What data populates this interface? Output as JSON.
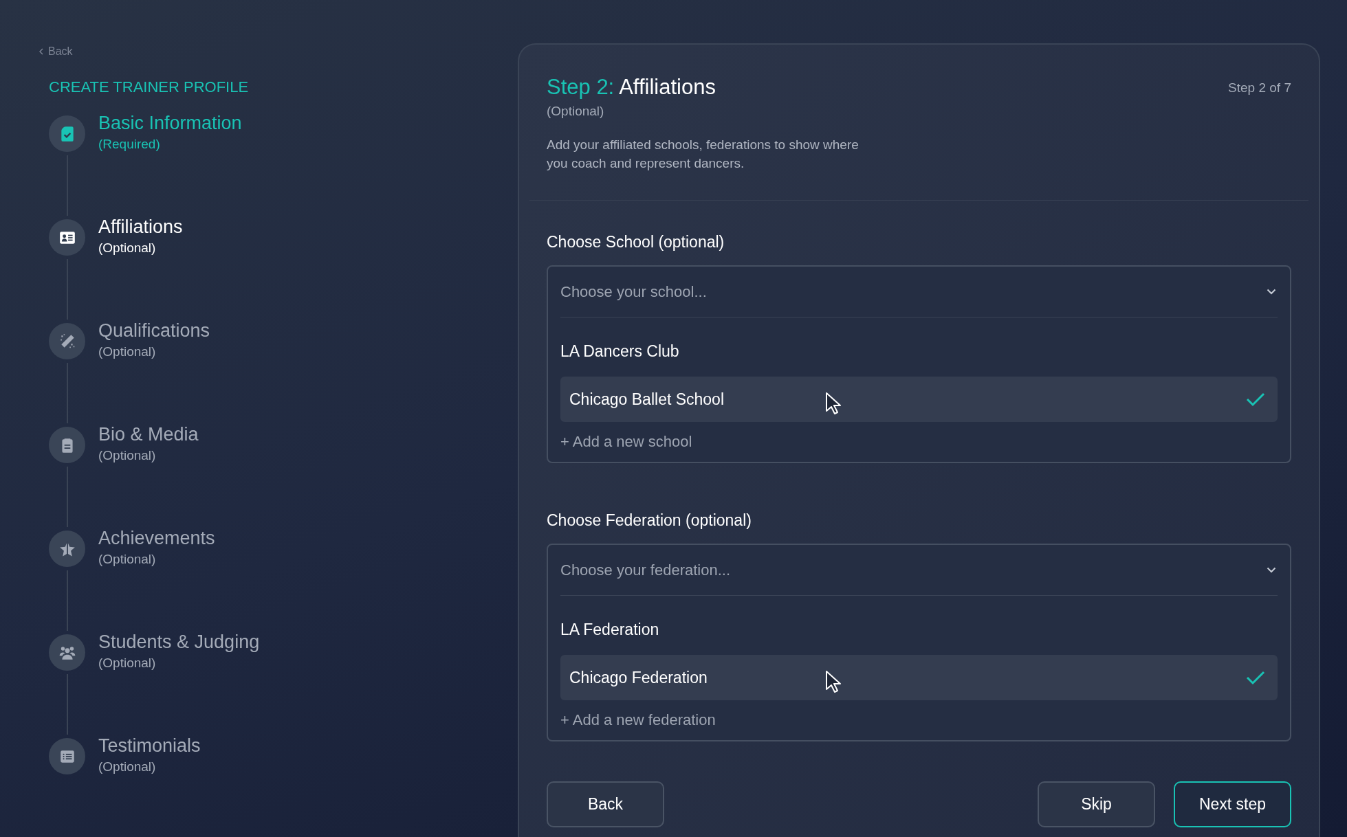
{
  "back_link": {
    "label": "Back"
  },
  "sidebar": {
    "title": "CREATE TRAINER PROFILE",
    "steps": [
      {
        "title": "Basic Information",
        "subtitle": "(Required)",
        "completed": true,
        "selected": false
      },
      {
        "title": "Affiliations",
        "subtitle": "(Optional)",
        "completed": false,
        "selected": true
      },
      {
        "title": "Qualifications",
        "subtitle": "(Optional)",
        "completed": false,
        "selected": false
      },
      {
        "title": "Bio & Media",
        "subtitle": "(Optional)",
        "completed": false,
        "selected": false
      },
      {
        "title": "Achievements",
        "subtitle": "(Optional)",
        "completed": false,
        "selected": false
      },
      {
        "title": "Students & Judging",
        "subtitle": "(Optional)",
        "completed": false,
        "selected": false
      },
      {
        "title": "Testimonials",
        "subtitle": "(Optional)",
        "completed": false,
        "selected": false
      }
    ]
  },
  "panel": {
    "step_label": "Step 2:",
    "title": "Affiliations",
    "subtitle": "(Optional)",
    "step_counter": "Step 2 of 7",
    "description": "Add your affiliated schools, federations to show where you coach and represent dancers.",
    "dropdowns": [
      {
        "label": "Choose School (optional)",
        "placeholder": "Choose your school...",
        "options": [
          {
            "label": "LA Dancers Club",
            "selected": false
          },
          {
            "label": "Chicago Ballet School",
            "selected": true
          }
        ],
        "add_label": "+ Add a new school"
      },
      {
        "label": "Choose Federation (optional)",
        "placeholder": "Choose your federation...",
        "options": [
          {
            "label": "LA Federation",
            "selected": false
          },
          {
            "label": "Chicago Federation",
            "selected": true
          }
        ],
        "add_label": "+ Add a new federation"
      }
    ],
    "buttons": {
      "back": "Back",
      "skip": "Skip",
      "next": "Next step"
    }
  }
}
